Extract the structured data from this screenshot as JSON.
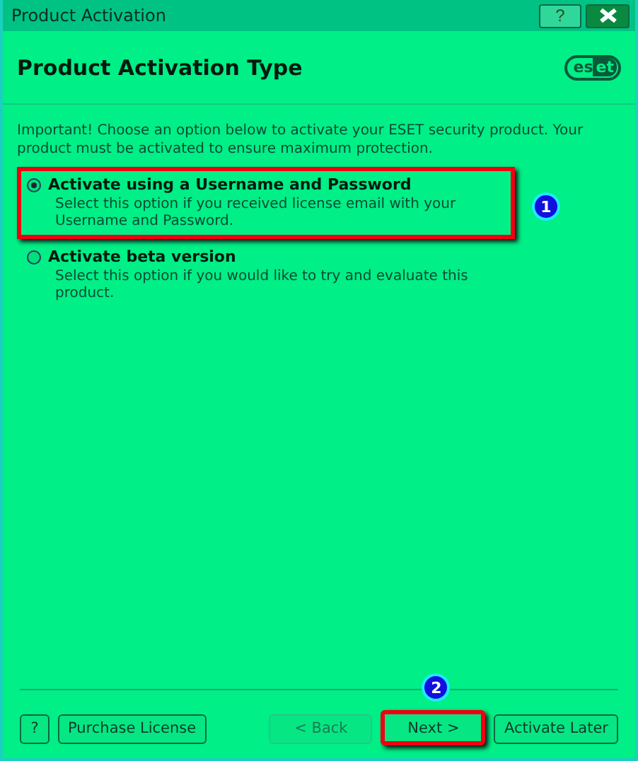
{
  "window": {
    "title": "Product Activation",
    "help_icon": "?"
  },
  "header": {
    "title": "Product Activation Type",
    "logo": "eset"
  },
  "intro": "Important! Choose an option below to activate your ESET security product. Your product must be activated to ensure maximum protection.",
  "options": [
    {
      "label": "Activate using a Username and Password",
      "description": "Select this option if you received license email with your Username and Password.",
      "selected": true,
      "highlighted": true,
      "marker": "1"
    },
    {
      "label": "Activate beta version",
      "description": "Select this option if you would like to try and evaluate this product.",
      "selected": false,
      "highlighted": false
    }
  ],
  "buttons": [
    {
      "label": "?",
      "disabled": false,
      "highlighted": false
    },
    {
      "label": "Purchase License",
      "disabled": false,
      "highlighted": false
    },
    {
      "label": "< Back",
      "disabled": true,
      "highlighted": false
    },
    {
      "label": "Next >",
      "disabled": false,
      "highlighted": true,
      "marker": "2"
    },
    {
      "label": "Activate Later",
      "disabled": false,
      "highlighted": false
    }
  ]
}
